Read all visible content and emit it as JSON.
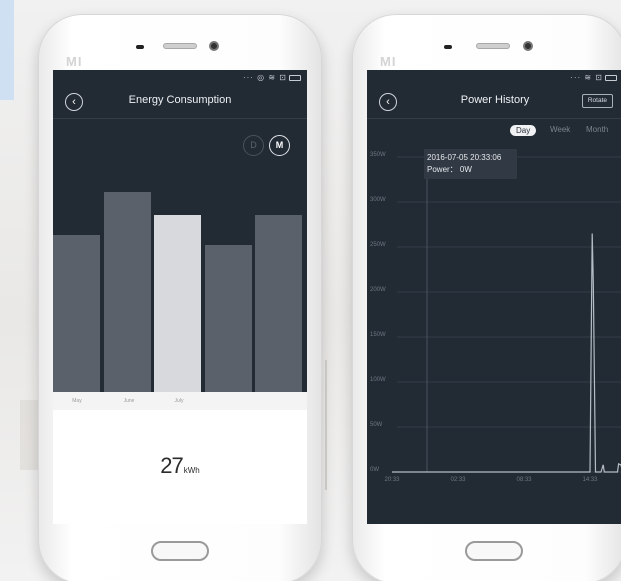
{
  "energy_screen": {
    "title": "Energy Consumption",
    "back_icon": "chevron-left-icon",
    "toggle_day": "D",
    "toggle_month": "M",
    "selected_toggle": "M",
    "months": [
      "May",
      "June",
      "July"
    ],
    "bars": [
      {
        "value": 0.63,
        "selected": false
      },
      {
        "value": 0.8,
        "selected": false
      },
      {
        "value": 0.71,
        "selected": true
      },
      {
        "value": 0.59,
        "selected": false
      },
      {
        "value": 0.71,
        "selected": false
      }
    ],
    "energy_value": "27",
    "energy_unit": "kWh"
  },
  "power_screen": {
    "title": "Power History",
    "rotate_label": "Rotate",
    "tabs": [
      "Day",
      "Week",
      "Month"
    ],
    "active_tab": "Day",
    "tooltip_time": "2016-07-05 20:33:06",
    "tooltip_power": "Power： 0W",
    "colors": {
      "line": "#b5bcc4",
      "grid": "#343c47",
      "cursor": "#4b5360"
    }
  },
  "chart_data": {
    "type": "line",
    "title": "Power History",
    "xlabel": "",
    "ylabel": "",
    "x_ticks": [
      "20:33",
      "02:33",
      "08:33",
      "14:33"
    ],
    "y_ticks": [
      "0W",
      "50W",
      "100W",
      "150W",
      "200W",
      "250W",
      "300W",
      "350W"
    ],
    "ylim": [
      0,
      350
    ],
    "grid": true,
    "series": [
      {
        "x": [
          0,
          18,
          18.2,
          18.3,
          18.5,
          18.6,
          19,
          19.2,
          19.3,
          20,
          20.5,
          20.6,
          20.8,
          21,
          21.1,
          21.2,
          21.3,
          22
        ],
        "y": [
          0,
          0,
          265,
          210,
          0,
          0,
          0,
          8,
          0,
          0,
          0,
          9,
          8,
          0,
          0,
          0,
          0,
          0
        ]
      }
    ],
    "x_ticks_hours": [
      0,
      6,
      12,
      18
    ],
    "x_range_hours": [
      0,
      20
    ]
  }
}
